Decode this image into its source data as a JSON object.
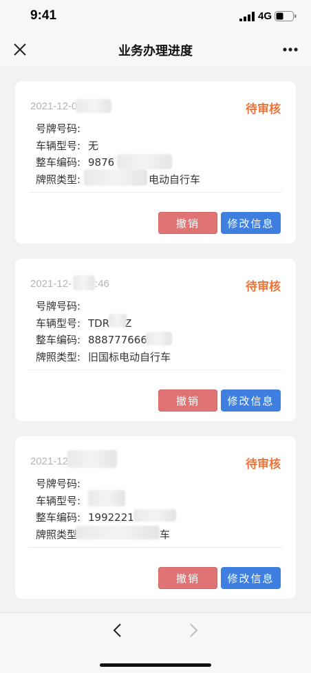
{
  "status_bar": {
    "time": "9:41",
    "network": "4G"
  },
  "nav": {
    "title": "业务办理进度",
    "close_icon": "close-icon",
    "more_icon": "more-icon"
  },
  "labels": {
    "plate_number": "号牌号码:",
    "vehicle_model": "车辆型号:",
    "vehicle_code": "整车编码:",
    "plate_type": "牌照类型:"
  },
  "buttons": {
    "cancel": "撤销",
    "edit": "修改信息"
  },
  "colors": {
    "status_orange": "#e8763c",
    "cancel_red": "#e07474",
    "edit_blue": "#3f7fe0"
  },
  "cards": [
    {
      "date": "2021-12-0",
      "status": "待审核",
      "plate_number": "",
      "vehicle_model": "无",
      "vehicle_code": "9876",
      "plate_type": "电动自行车"
    },
    {
      "date": "2021-12-",
      "date_tail": ":46",
      "status": "待审核",
      "plate_number": "",
      "vehicle_model": "TDR",
      "vehicle_model_tail": "Z",
      "vehicle_code": "888777666",
      "plate_type": "旧国标电动自行车"
    },
    {
      "date": "2021-12",
      "status": "待审核",
      "plate_number": "",
      "vehicle_model": "",
      "vehicle_code": "19922218",
      "plate_type": "车"
    }
  ],
  "bottom_nav": {
    "back_icon": "chevron-left-icon",
    "forward_icon": "chevron-right-icon"
  }
}
